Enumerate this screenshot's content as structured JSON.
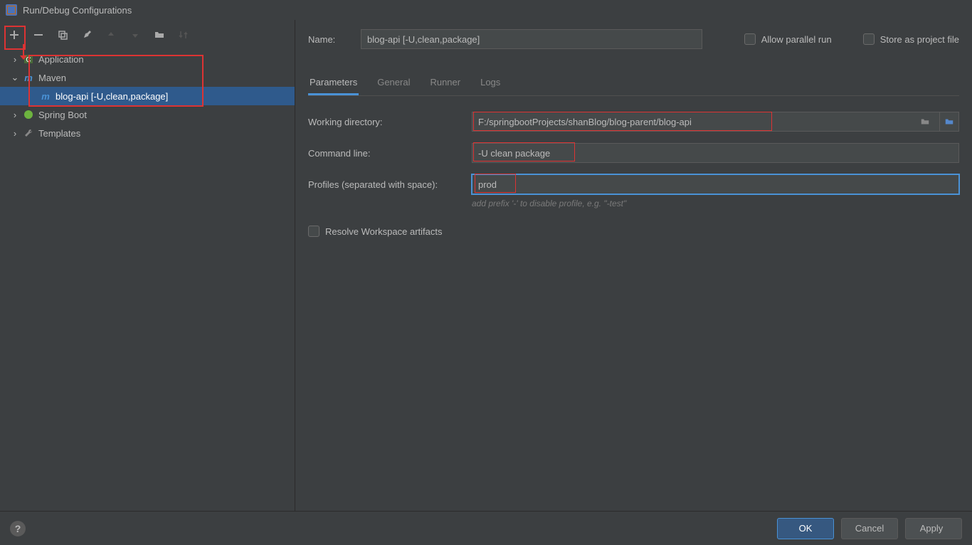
{
  "window": {
    "title": "Run/Debug Configurations"
  },
  "toolbar": {
    "add": "+",
    "remove": "−",
    "copy": "⧉",
    "edit": "🔧",
    "up": "▲",
    "down": "▼",
    "folder": "📁",
    "sort": "↕"
  },
  "tree": {
    "application": "Application",
    "maven": "Maven",
    "maven_child": "blog-api [-U,clean,package]",
    "spring_boot": "Spring Boot",
    "templates": "Templates"
  },
  "form": {
    "name_label": "Name:",
    "name_value": "blog-api [-U,clean,package]",
    "allow_parallel": "Allow parallel run",
    "store_project": "Store as project file"
  },
  "tabs": {
    "parameters": "Parameters",
    "general": "General",
    "runner": "Runner",
    "logs": "Logs"
  },
  "params": {
    "working_dir_label": "Working directory:",
    "working_dir_value": "F:/springbootProjects/shanBlog/blog-parent/blog-api",
    "command_line_label": "Command line:",
    "command_line_value": "-U clean package",
    "profiles_label": "Profiles (separated with space):",
    "profiles_value": "prod",
    "profiles_hint": "add prefix '-' to disable profile, e.g. \"-test\"",
    "resolve_label": "Resolve Workspace artifacts"
  },
  "footer": {
    "ok": "OK",
    "cancel": "Cancel",
    "apply": "Apply"
  }
}
